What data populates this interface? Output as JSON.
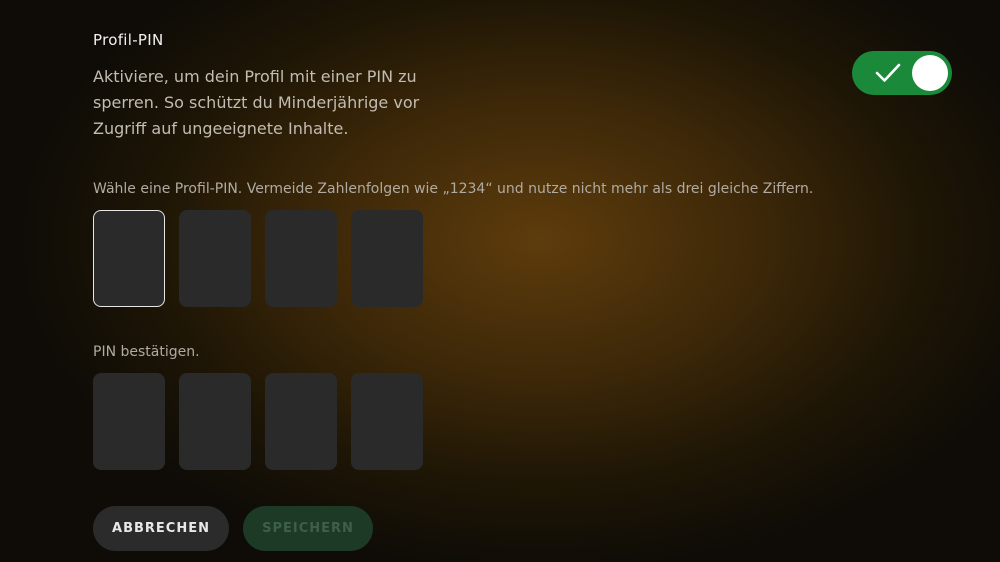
{
  "profile_pin": {
    "title": "Profil-PIN",
    "description": "Aktiviere, um dein Profil mit einer PIN zu sperren. So schützt du Minderjährige vor Zugriff auf ungeeignete Inhalte.",
    "toggle": {
      "state": "on",
      "icon": "check-icon",
      "color": "#1a8a3a"
    }
  },
  "pin_entry": {
    "hint": "Wähle eine Profil-PIN. Vermeide Zahlenfolgen wie „1234“ und nutze nicht mehr als drei gleiche Ziffern.",
    "digits": [
      "",
      "",
      "",
      ""
    ]
  },
  "pin_confirm": {
    "label": "PIN bestätigen.",
    "digits": [
      "",
      "",
      "",
      ""
    ]
  },
  "actions": {
    "cancel_label": "ABBRECHEN",
    "save_label": "SPEICHERN"
  }
}
